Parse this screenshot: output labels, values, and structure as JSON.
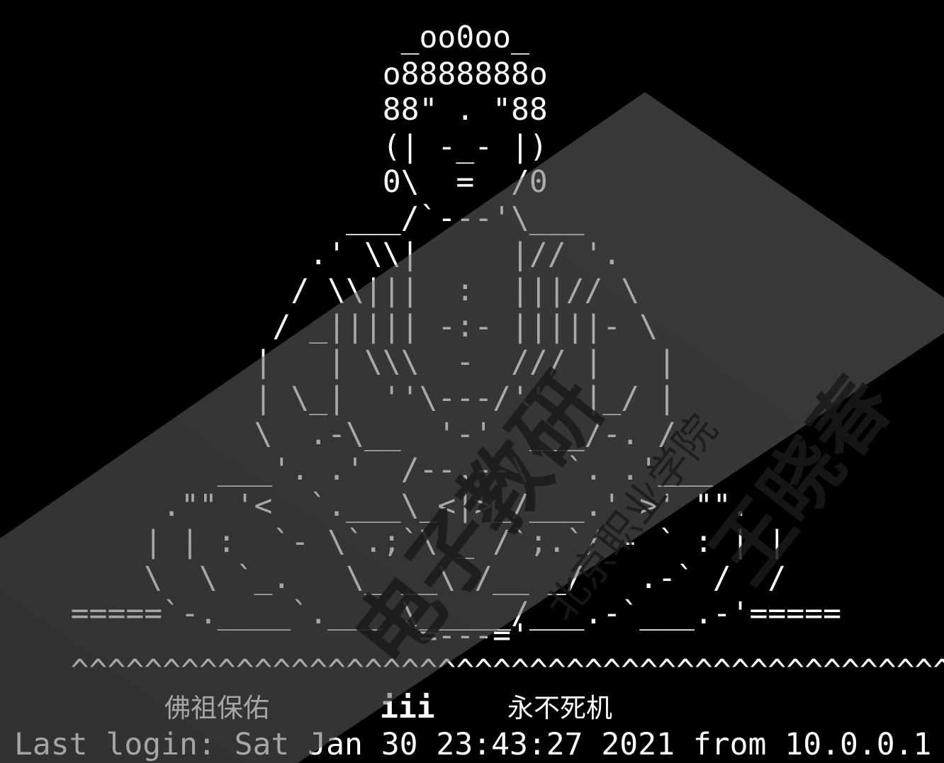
{
  "terminal": {
    "banner_lines": [
      "                     _oo0oo_",
      "                    o8888888o",
      "                    88\" . \"88",
      "                    (| -_- |)",
      "                    0\\  =  /0",
      "                  ___/`---'\\___",
      "                .' \\\\|     |// '.",
      "               / \\\\|||  :  |||// \\",
      "              / _||||| -:- |||||- \\",
      "             |   | \\\\\\  -  /// |   |",
      "             | \\_|  ''\\---/''  |_/ |",
      "             \\  .-\\__  '-'  ___/-. /",
      "           ___'. .'  /--.--\\  `. .'___",
      "        .\"\" '<  `.___\\_<|>_/___.' >' \"\".",
      "       | | :  `- \\`.;`\\ _ /`;.`/ - ` : | |",
      "       \\  \\ `_.   \\_ __\\ /__ _/   .-` /  /",
      "   =====`-.____`.___ \\_____/___.-`___.-'=====",
      "                     `=---='",
      "",
      "   ^^^^^^^^^^^^^^^^^^^^^^^^^^^^^^^^^^^^^^^^^^^^^^^^^"
    ],
    "blessing": {
      "left": "佛祖保佑",
      "middle": "iii",
      "right": "永不死机"
    },
    "last_login": "Last login: Sat Jan 30 23:43:27 2021 from 10.0.0.1"
  },
  "watermark": {
    "lines": [
      "王晓春",
      "北京职业学院",
      "电子教研"
    ],
    "color": "#7a7a7a"
  }
}
